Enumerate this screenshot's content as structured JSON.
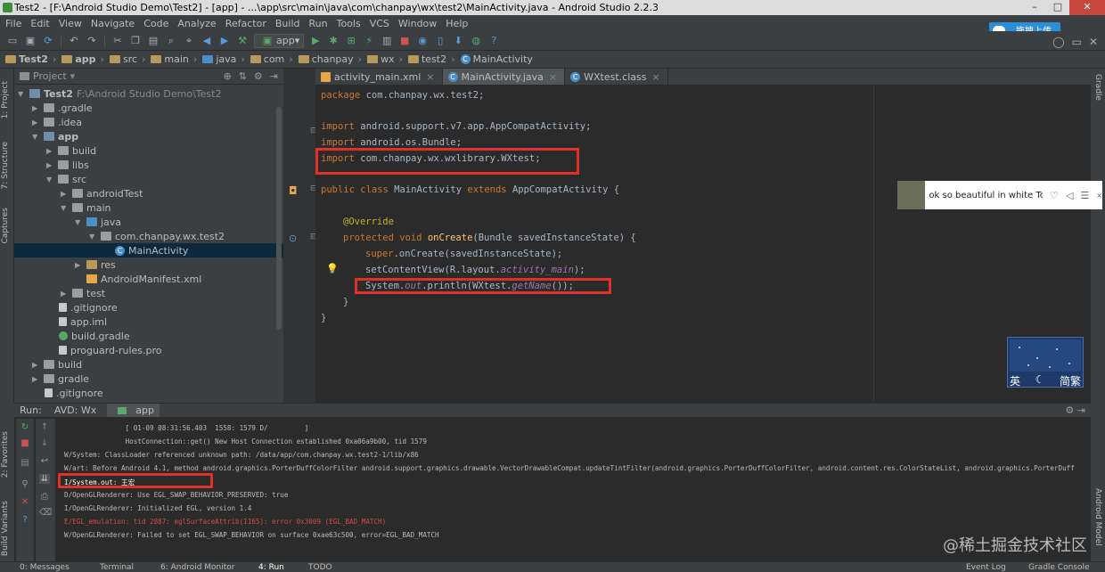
{
  "window": {
    "title": "Test2 - [F:\\Android Studio Demo\\Test2] - [app] - ...\\app\\src\\main\\java\\com\\chanpay\\wx\\test2\\MainActivity.java - Android Studio 2.2.3",
    "controls": [
      "–",
      "□",
      "✕"
    ]
  },
  "menu": [
    "File",
    "Edit",
    "View",
    "Navigate",
    "Code",
    "Analyze",
    "Refactor",
    "Build",
    "Run",
    "Tools",
    "VCS",
    "Window",
    "Help"
  ],
  "toolbar": {
    "run_config": "app"
  },
  "overlay": {
    "baidu_upload": "拖拽上传"
  },
  "breadcrumb": [
    "Test2",
    "app",
    "src",
    "main",
    "java",
    "com",
    "chanpay",
    "wx",
    "test2",
    "MainActivity"
  ],
  "left_tool_tabs": [
    "1: Project",
    "7: Structure",
    "Captures",
    "2: Favorites",
    "Build Variants"
  ],
  "right_tool_tabs": [
    "Gradle",
    "Android Model"
  ],
  "project": {
    "view_label": "Project",
    "tree": [
      {
        "label": "Test2",
        "note": "F:\\Android Studio Demo\\Test2",
        "icon": "module-folder-icon",
        "bold": true
      },
      {
        "label": ".gradle",
        "icon": "folder-icon"
      },
      {
        "label": ".idea",
        "icon": "folder-icon"
      },
      {
        "label": "app",
        "icon": "module-folder-icon",
        "bold": true
      },
      {
        "label": "build",
        "icon": "folder-icon"
      },
      {
        "label": "libs",
        "icon": "folder-icon"
      },
      {
        "label": "src",
        "icon": "folder-icon"
      },
      {
        "label": "androidTest",
        "icon": "folder-icon"
      },
      {
        "label": "main",
        "icon": "folder-icon"
      },
      {
        "label": "java",
        "icon": "source-folder-icon"
      },
      {
        "label": "com.chanpay.wx.test2",
        "icon": "package-icon"
      },
      {
        "label": "MainActivity",
        "icon": "class-icon",
        "selected": true
      },
      {
        "label": "res",
        "icon": "resource-folder-icon"
      },
      {
        "label": "AndroidManifest.xml",
        "icon": "xml-file-icon"
      },
      {
        "label": "test",
        "icon": "folder-icon"
      },
      {
        "label": ".gitignore",
        "icon": "file-icon"
      },
      {
        "label": "app.iml",
        "icon": "file-icon"
      },
      {
        "label": "build.gradle",
        "icon": "gradle-icon"
      },
      {
        "label": "proguard-rules.pro",
        "icon": "file-icon"
      },
      {
        "label": "build",
        "icon": "folder-icon"
      },
      {
        "label": "gradle",
        "icon": "folder-icon"
      },
      {
        "label": ".gitignore",
        "icon": "file-icon"
      }
    ]
  },
  "editor": {
    "tabs": [
      {
        "label": "activity_main.xml",
        "icon": "xml-file-icon",
        "active": false
      },
      {
        "label": "MainActivity.java",
        "icon": "class-icon",
        "active": true
      },
      {
        "label": "WXtest.class",
        "icon": "class-icon",
        "active": false
      }
    ],
    "code": {
      "package": [
        "package ",
        "com.chanpay.wx.test2;"
      ],
      "import1": [
        "import ",
        "android.support.v7.app.AppCompatActivity;"
      ],
      "import2": [
        "import ",
        "android.os.Bundle;"
      ],
      "import3": [
        "import ",
        "com.chanpay.wx.wxlibrary.WXtest;"
      ],
      "class_decl": [
        "public class ",
        "MainActivity ",
        "extends ",
        "AppCompatActivity {"
      ],
      "annotation": "@Override",
      "method_decl": [
        "protected void ",
        "onCreate",
        "(Bundle savedInstanceState) {"
      ],
      "super_call": [
        "super",
        ".onCreate(savedInstanceState);"
      ],
      "set_content": [
        "setContentView(R.layout.",
        "activity_main",
        ");"
      ],
      "println": [
        "System.",
        "out",
        ".println(WXtest.",
        "getName",
        "());"
      ],
      "close1": "}",
      "close2": "}"
    }
  },
  "music_popup": {
    "track": "ok so beautiful in white Tor"
  },
  "ime": {
    "left": "英",
    "right": "简繁"
  },
  "run": {
    "label": "Run:",
    "tabs": [
      "AVD: Wx",
      "app"
    ],
    "console": [
      {
        "text": "               [ 01-09 08:31:56.403  1558: 1579 D/         ]",
        "type": "info"
      },
      {
        "text": "               HostConnection::get() New Host Connection established 0xa06a9b00, tid 1579",
        "type": "info"
      },
      {
        "text": "W/System: ClassLoader referenced unknown path: /data/app/com.chanpay.wx.test2-1/lib/x86",
        "type": "info"
      },
      {
        "text": "W/art: Before Android 4.1, method android.graphics.PorterDuffColorFilter android.support.graphics.drawable.VectorDrawableCompat.updateTintFilter(android.graphics.PorterDuffColorFilter, android.content.res.ColorStateList, android.graphics.PorterDuff",
        "type": "info"
      },
      {
        "text": "I/System.out: 王宏",
        "type": "info"
      },
      {
        "text": "D/OpenGLRenderer: Use EGL_SWAP_BEHAVIOR_PRESERVED: true",
        "type": "info"
      },
      {
        "text": "I/OpenGLRenderer: Initialized EGL, version 1.4",
        "type": "info"
      },
      {
        "text": "E/EGL_emulation: tid 2887: eglSurfaceAttrib(1165): error 0x3009 (EGL_BAD_MATCH)",
        "type": "error"
      },
      {
        "text": "W/OpenGLRenderer: Failed to set EGL_SWAP_BEHAVIOR on surface 0xae63c500, error=EGL_BAD_MATCH",
        "type": "info"
      }
    ]
  },
  "statusbar": [
    "0: Messages",
    "Terminal",
    "6: Android Monitor",
    "4: Run",
    "TODO",
    "Event Log",
    "Gradle Console"
  ],
  "watermark": "@稀土掘金技术社区",
  "colors": {
    "highlight_box": "#e0302a",
    "editor_bg": "#2b2b2b",
    "panel_bg": "#3c3f41",
    "keyword": "#cc7832",
    "annotation": "#bbb529",
    "method": "#ffc66d",
    "field": "#9876aa",
    "error_text": "#d24d43"
  }
}
